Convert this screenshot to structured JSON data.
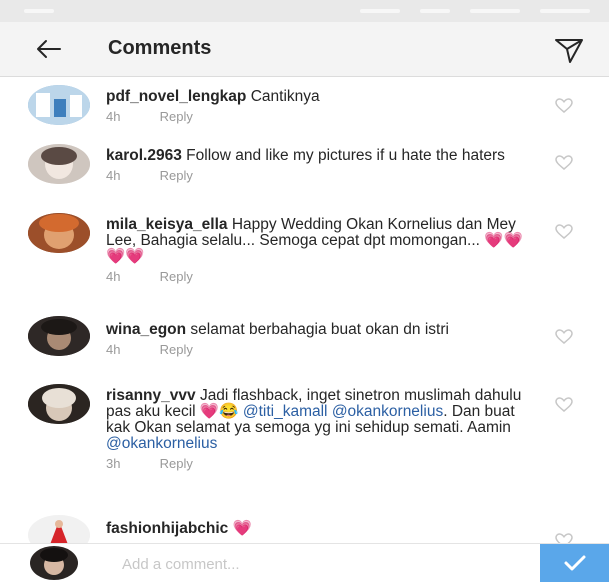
{
  "header": {
    "title": "Comments"
  },
  "icons": {
    "back": "arrow-left-icon",
    "send": "paper-plane-icon",
    "like": "heart-outline-icon",
    "post": "checkmark-icon"
  },
  "comments": [
    {
      "username": "pdf_novel_lengkap",
      "text": "Cantiknya",
      "time": "4h",
      "reply": "Reply"
    },
    {
      "username": "karol.2963",
      "text": "Follow and like my pictures if u hate the haters",
      "time": "4h",
      "reply": "Reply"
    },
    {
      "username": "mila_keisya_ella",
      "text": "Happy Wedding Okan Kornelius dan Mey Lee, Bahagia selalu... Semoga cepat dpt momongan...",
      "emoji": "💗💗💗💗",
      "time": "4h",
      "reply": "Reply"
    },
    {
      "username": "wina_egon",
      "text": "selamat berbahagia buat okan dn istri",
      "time": "4h",
      "reply": "Reply"
    },
    {
      "username": "risanny_vvv",
      "text": "Jadi flashback, inget sinetron muslimah dahulu pas aku kecil",
      "emoji": "💗😂",
      "mention1": "@titi_kamall",
      "mention2": "@okankornelius",
      "text2": ". Dan buat kak Okan selamat ya semoga yg ini sehidup semati. Aamin",
      "mention3": "@okankornelius",
      "time": "3h",
      "reply": "Reply"
    },
    {
      "username": "fashionhijabchic",
      "emoji": "💗"
    }
  ],
  "composer": {
    "placeholder": "Add a comment..."
  },
  "colors": {
    "accent": "#5aa7ea",
    "mention": "#2b5fa3",
    "muted": "#999999"
  }
}
